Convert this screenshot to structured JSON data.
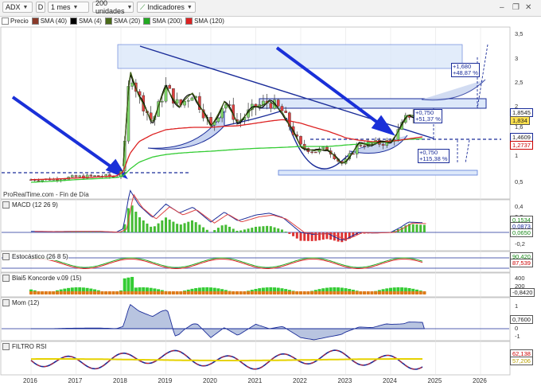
{
  "toolbar": {
    "symbol": "ADX",
    "d_label": "D",
    "period": "1 mes",
    "units": "200 unidades",
    "indicators": "Indicadores",
    "window_icons": [
      "minimize-icon",
      "restore-icon",
      "close-icon"
    ]
  },
  "legend": [
    {
      "label": "Precio",
      "color": "#888888"
    },
    {
      "label": "SMA (40)",
      "color": "#8a3a2a"
    },
    {
      "label": "SMA (4)",
      "color": "#000000"
    },
    {
      "label": "SMA (20)",
      "color": "#4a6a1a"
    },
    {
      "label": "SMA (200)",
      "color": "#22aa22"
    },
    {
      "label": "SMA (120)",
      "color": "#dd2222"
    }
  ],
  "source_text": "ProRealTime.com - Fin de Día",
  "panes": {
    "macd": {
      "title": "MACD (12 26 9)",
      "labels": [
        "0,1534",
        "0,0873",
        "0,0650"
      ],
      "axis": [
        "0,4",
        "0,2",
        "0",
        "-0,2"
      ]
    },
    "stoch": {
      "title": "Estocástico (26 8 5)",
      "labels": [
        "90,420",
        "87,539"
      ]
    },
    "blai": {
      "title": "Blai5 Koncorde v.09 (15)",
      "labels": [
        "-0,8420"
      ],
      "axis": [
        "400",
        "200",
        "0"
      ]
    },
    "mom": {
      "title": "Mom (12)",
      "labels": [
        "0,7600"
      ],
      "axis": [
        "1",
        "0",
        "-1"
      ]
    },
    "rsi": {
      "title": "FILTRO RSI",
      "labels": [
        "62,138",
        "57,206"
      ]
    }
  },
  "price_axis": [
    "3,5",
    "3",
    "2,5",
    "2",
    "1,6",
    "1",
    "0,5"
  ],
  "price_labels": {
    "p1": "1,8545",
    "p2": "1,834",
    "p3": "1,4609",
    "p4": "1,2737"
  },
  "annotations": {
    "top": [
      "+1,680",
      "+48,87 %"
    ],
    "mid": [
      "+0,750",
      "+51,37 %"
    ],
    "low": [
      "+0,750",
      "+115,38 %"
    ]
  },
  "x_axis": [
    "2016",
    "2017",
    "2018",
    "2019",
    "2020",
    "2021",
    "2022",
    "2023",
    "2024",
    "2025",
    "2026"
  ],
  "chart_data": {
    "type": "line",
    "title": "ADX",
    "x": [
      2016.0,
      2016.5,
      2017.0,
      2017.5,
      2017.9,
      2018.05,
      2018.2,
      2018.4,
      2018.7,
      2019.0,
      2019.3,
      2019.6,
      2020.0,
      2020.3,
      2020.6,
      2021.0,
      2021.3,
      2021.6,
      2022.0,
      2022.3,
      2022.6,
      2022.9,
      2023.0,
      2023.3,
      2023.6,
      2024.0,
      2024.2,
      2024.4,
      2024.7
    ],
    "series": [
      {
        "name": "Precio",
        "values": [
          0.55,
          0.56,
          0.6,
          0.62,
          0.6,
          0.8,
          2.8,
          2.2,
          1.7,
          2.4,
          2.0,
          2.3,
          1.6,
          2.1,
          1.7,
          2.0,
          2.1,
          1.9,
          1.2,
          1.1,
          1.15,
          0.85,
          0.9,
          1.25,
          1.25,
          1.3,
          1.55,
          1.85,
          1.83
        ]
      },
      {
        "name": "SMA (200)",
        "values": [
          0.5,
          0.52,
          0.55,
          0.57,
          0.59,
          0.62,
          0.75,
          0.88,
          0.98,
          1.03,
          1.06,
          1.08,
          1.1,
          1.12,
          1.14,
          1.16,
          1.17,
          1.18,
          1.2,
          1.2,
          1.2,
          1.22,
          1.23,
          1.25,
          1.28,
          1.3,
          1.33,
          1.35,
          1.36
        ]
      },
      {
        "name": "SMA (120)",
        "values": [
          0.55,
          0.56,
          0.58,
          0.6,
          0.62,
          0.7,
          1.05,
          1.3,
          1.45,
          1.55,
          1.58,
          1.6,
          1.6,
          1.62,
          1.63,
          1.68,
          1.72,
          1.75,
          1.68,
          1.6,
          1.52,
          1.42,
          1.38,
          1.33,
          1.3,
          1.31,
          1.33,
          1.36,
          1.4
        ]
      }
    ],
    "ylim": [
      0.3,
      3.6
    ]
  }
}
